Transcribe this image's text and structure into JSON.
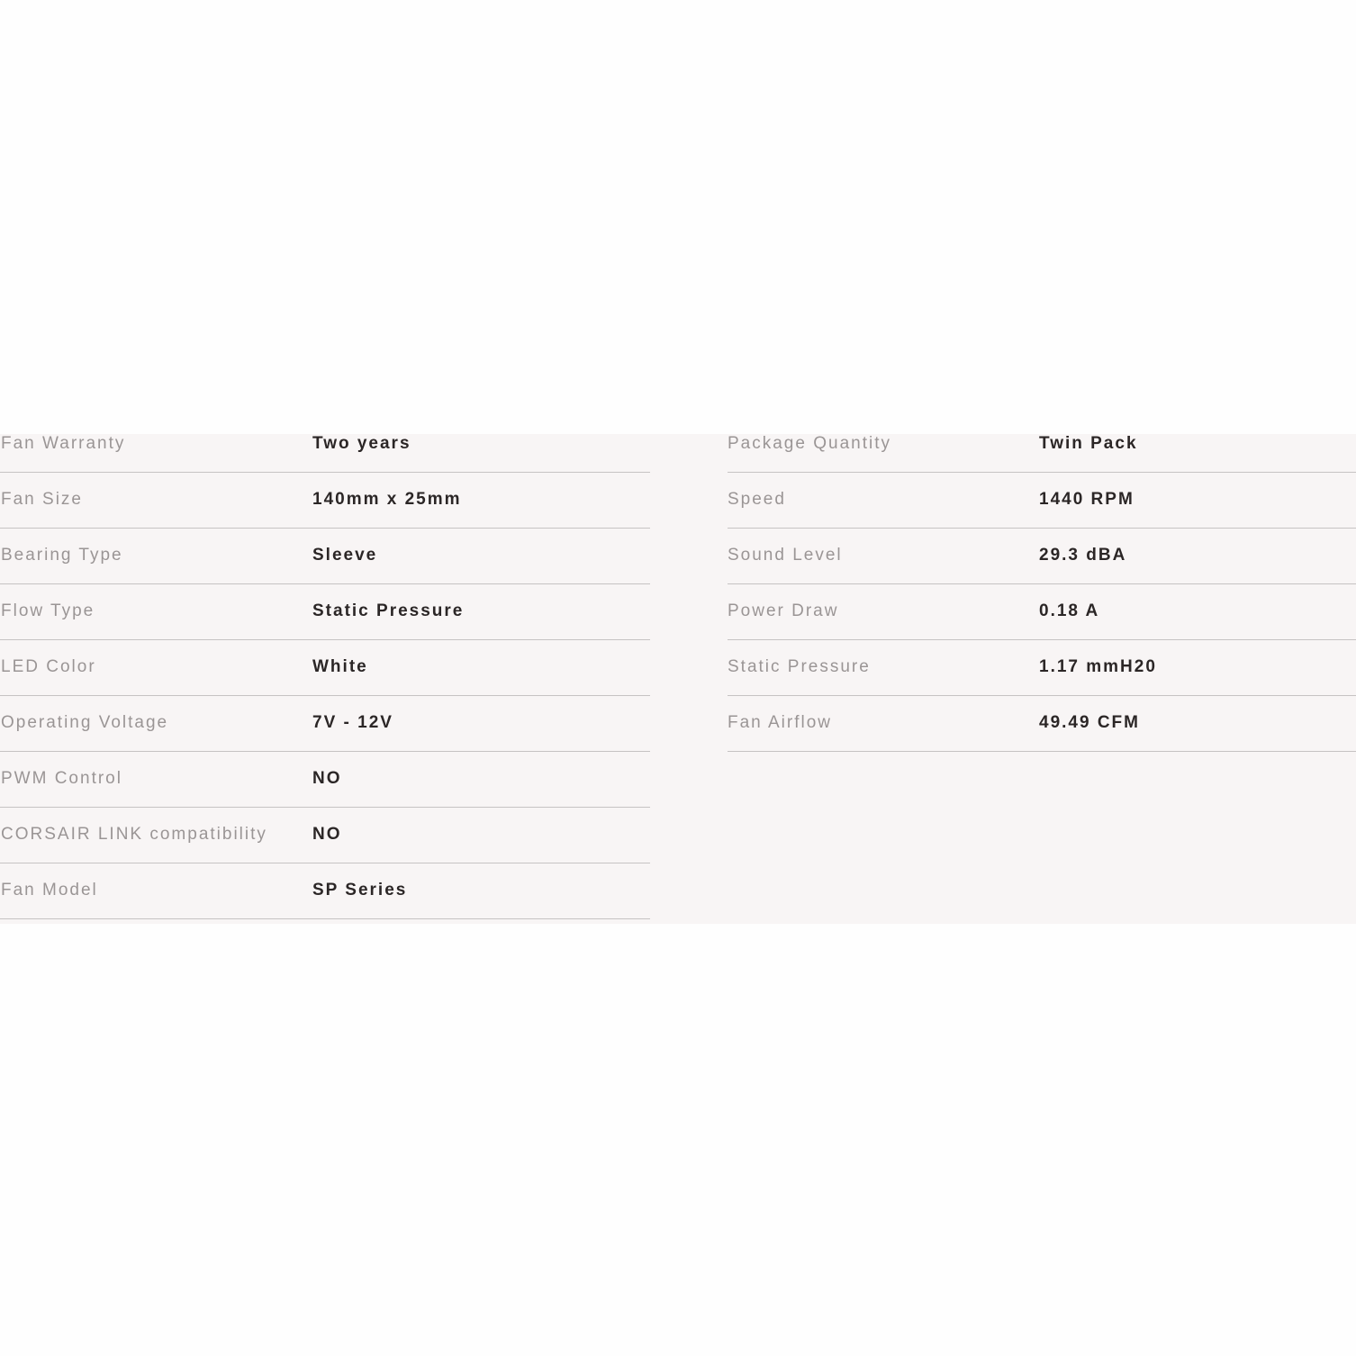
{
  "specs_left": [
    {
      "label": "Fan Warranty",
      "value": "Two years"
    },
    {
      "label": "Fan Size",
      "value": "140mm x 25mm"
    },
    {
      "label": "Bearing Type",
      "value": "Sleeve"
    },
    {
      "label": "Flow Type",
      "value": "Static Pressure"
    },
    {
      "label": "LED Color",
      "value": "White"
    },
    {
      "label": "Operating Voltage",
      "value": "7V - 12V"
    },
    {
      "label": "PWM Control",
      "value": "NO"
    },
    {
      "label": "CORSAIR LINK compatibility",
      "value": "NO"
    },
    {
      "label": "Fan Model",
      "value": "SP Series"
    }
  ],
  "specs_right": [
    {
      "label": "Package Quantity",
      "value": "Twin Pack"
    },
    {
      "label": "Speed",
      "value": "1440 RPM"
    },
    {
      "label": "Sound Level",
      "value": "29.3 dBA"
    },
    {
      "label": "Power Draw",
      "value": "0.18 A"
    },
    {
      "label": "Static Pressure",
      "value": "1.17 mmH20"
    },
    {
      "label": "Fan Airflow",
      "value": "49.49 CFM"
    }
  ],
  "colors": {
    "panel_background": "#f8f5f5",
    "label_text": "#9a9595",
    "value_text": "#2b2626",
    "divider": "#c6c3c3"
  }
}
